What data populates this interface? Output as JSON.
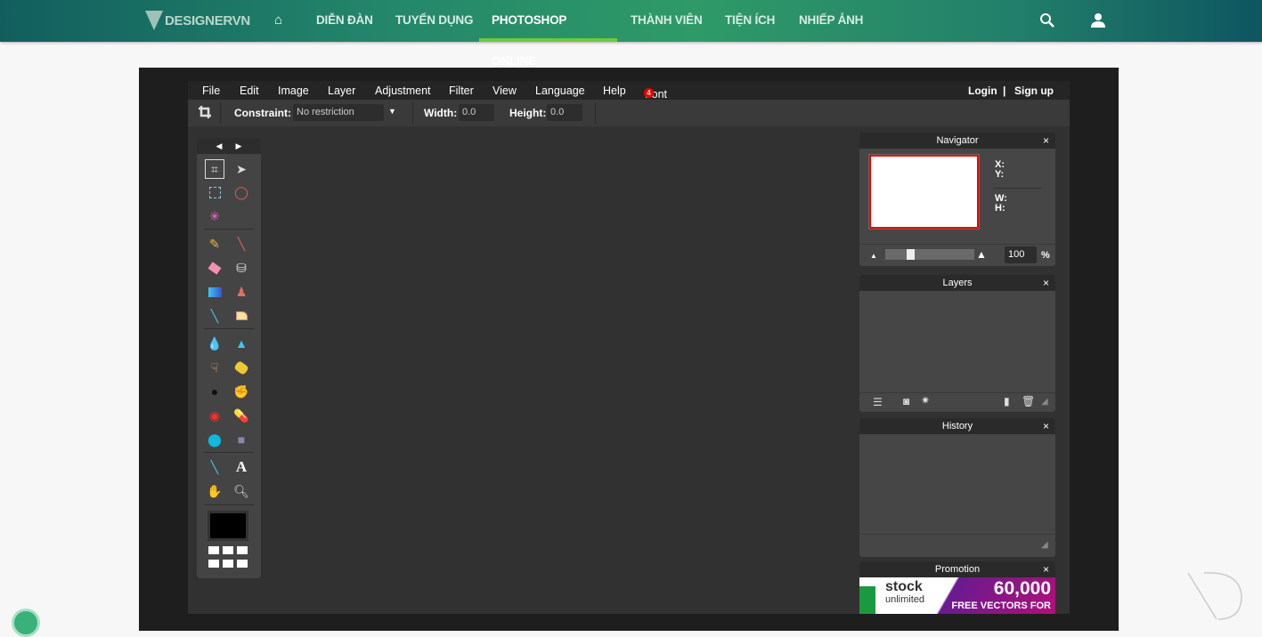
{
  "site_nav": {
    "logo_text": "DESIGNERVN",
    "home_icon": "home-icon",
    "items": [
      {
        "label": "DIỄN ĐÀN",
        "active": false
      },
      {
        "label": "TUYỂN DỤNG",
        "active": false
      },
      {
        "label": "PHOTOSHOP ONLINE",
        "active": true
      },
      {
        "label": "THÀNH VIÊN",
        "active": false
      },
      {
        "label": "TIỆN ÍCH",
        "active": false
      },
      {
        "label": "NHIẾP ẢNH",
        "active": false
      }
    ],
    "search_icon": "search-icon",
    "user_icon": "user-icon",
    "accent_color": "#6ccb3f"
  },
  "editor": {
    "menu": [
      "File",
      "Edit",
      "Image",
      "Layer",
      "Adjustment",
      "Filter",
      "View",
      "Language",
      "Help",
      "Font"
    ],
    "font_badge": "4",
    "login": "Login",
    "divider": "|",
    "signup": "Sign up",
    "toolbar": {
      "constraint_label": "Constraint:",
      "constraint_value": "No restriction",
      "width_label": "Width:",
      "width_value": "0.0",
      "height_label": "Height:",
      "height_value": "0.0"
    },
    "navigator": {
      "title": "Navigator",
      "x_label": "X:",
      "y_label": "Y:",
      "w_label": "W:",
      "h_label": "H:",
      "zoom_value": "100",
      "zoom_unit": "%"
    },
    "layers": {
      "title": "Layers"
    },
    "history": {
      "title": "History"
    },
    "promotion": {
      "title": "Promotion",
      "brand": "stock",
      "brand_sub": "unlimited",
      "headline": "60,000",
      "subline": "FREE VECTORS FOR"
    },
    "close": "×",
    "foreground_color": "#000000"
  }
}
